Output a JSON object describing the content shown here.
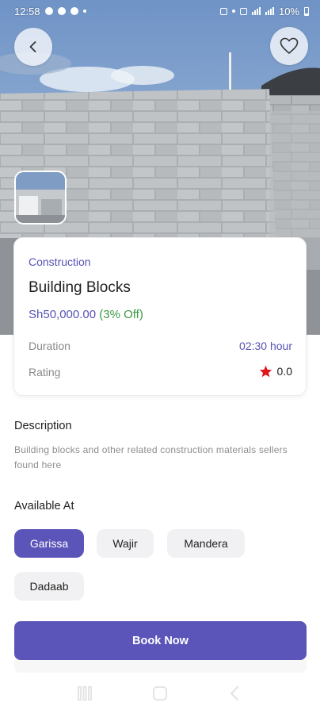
{
  "status_bar": {
    "time": "12:58",
    "battery": "10%"
  },
  "hero": {
    "image_description": "concrete blocks"
  },
  "product": {
    "category": "Construction",
    "name": "Building Blocks",
    "price": "Sh50,000.00",
    "discount": "(3% Off)",
    "duration_label": "Duration",
    "duration_value": "02:30 hour",
    "rating_label": "Rating",
    "rating_value": "0.0"
  },
  "description": {
    "title": "Description",
    "text": "Building blocks and other related construction materials sellers found here"
  },
  "available": {
    "title": "Available At",
    "locations": [
      "Garissa",
      "Wajir",
      "Mandera",
      "Dadaab"
    ],
    "selected": "Garissa"
  },
  "actions": {
    "book_label": "Book Now"
  },
  "colors": {
    "accent": "#5b55b9",
    "discount": "#3a9a45",
    "star": "#e0161b"
  },
  "icons": [
    "chevron-left-icon",
    "heart-icon",
    "star-icon",
    "recent-apps-icon",
    "home-icon",
    "back-icon"
  ]
}
